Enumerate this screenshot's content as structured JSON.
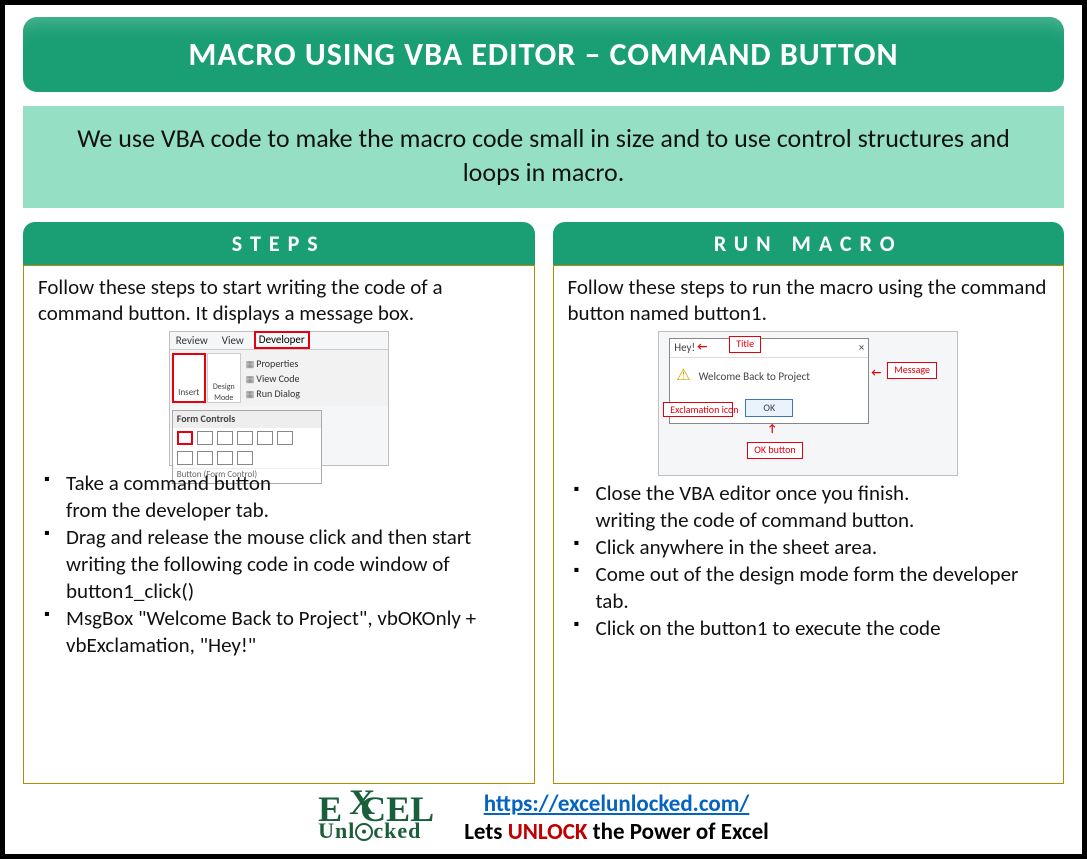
{
  "title": "MACRO USING VBA EDITOR – COMMAND BUTTON",
  "subtitle": "We use VBA code to make the macro code small in size and to use control structures and loops in macro.",
  "left": {
    "heading": "STEPS",
    "intro": "Follow these steps to start writing the code of a command button. It displays a message box.",
    "bullets": {
      "b1a": "Take a command button",
      "b1b": "from the developer tab.",
      "b2": "Drag and release the mouse click and then start writing the following code in code window of button1_click()",
      "b3": "MsgBox \"Welcome Back to Project\", vbOKOnly + vbExclamation, \"Hey!\""
    },
    "mock": {
      "tab_review": "Review",
      "tab_view": "View",
      "tab_dev": "Developer",
      "btn_insert": "Insert",
      "btn_design": "Design Mode",
      "prop_properties": "Properties",
      "prop_viewcode": "View Code",
      "prop_rundialog": "Run Dialog",
      "drop_title": "Form Controls",
      "drop_caption": "Button (Form Control)"
    }
  },
  "right": {
    "heading": "RUN MACRO",
    "intro": "Follow these steps to run the macro using the command button named button1.",
    "bullets": {
      "b1a": "Close the VBA editor once you finish.",
      "b1b": "writing the code of command button.",
      "b2": "Click anywhere in the sheet area.",
      "b3": "Come out of the design mode form the developer tab.",
      "b4": "Click on the button1 to execute the code"
    },
    "mock": {
      "titlebar": "Hey!",
      "close": "×",
      "message": "Welcome Back to Project",
      "ok": "OK",
      "label_title": "Title",
      "label_message": "Message",
      "label_icon": "Exclamation icon",
      "label_ok": "OK button"
    }
  },
  "footer": {
    "logo_top": "E   CEL",
    "logo_x": "X",
    "logo_sub": "Unl   cked",
    "url": "https://excelunlocked.com/",
    "tagline_a": "Lets ",
    "tagline_b": "UNLOCK",
    "tagline_c": " the Power of Excel"
  }
}
